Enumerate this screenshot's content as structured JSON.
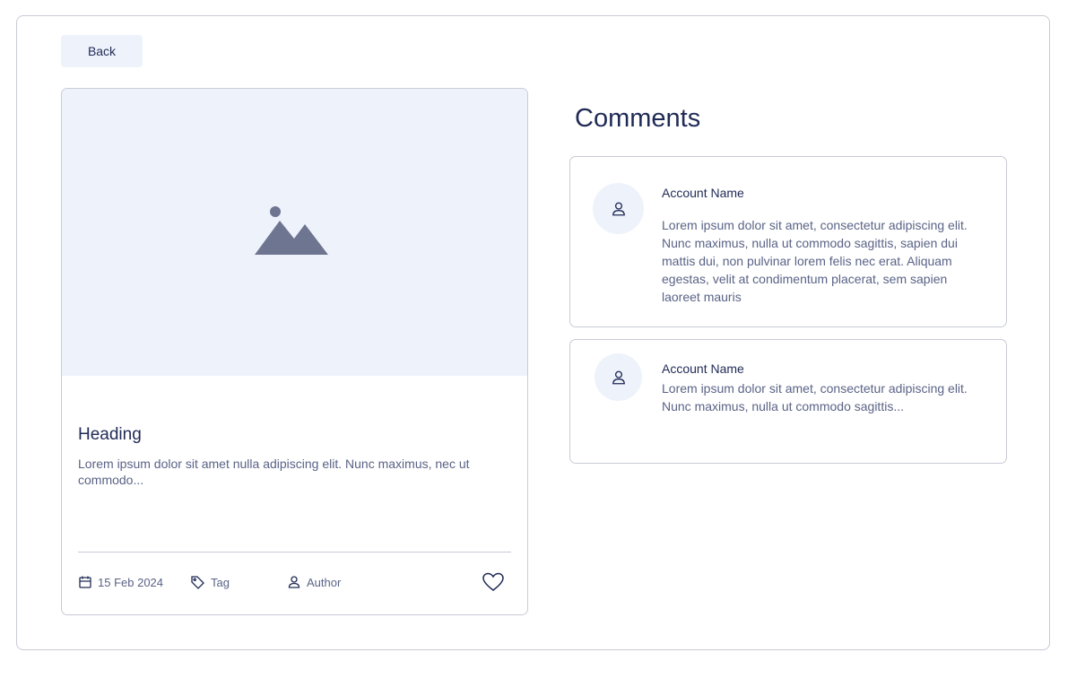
{
  "nav": {
    "back_label": "Back"
  },
  "post": {
    "heading": "Heading",
    "excerpt": "Lorem ipsum dolor sit amet nulla adipiscing elit. Nunc maximus, nec ut commodo...",
    "date": "15 Feb 2024",
    "tag": "Tag",
    "author": "Author",
    "image_icon": "image-placeholder-icon"
  },
  "comments": {
    "title": "Comments",
    "items": [
      {
        "account": "Account Name",
        "text": "Lorem ipsum dolor sit amet, consectetur adipiscing elit. Nunc maximus, nulla ut commodo sagittis, sapien dui mattis dui, non pulvinar lorem felis nec erat. Aliquam egestas, velit at condimentum placerat, sem sapien laoreet mauris"
      },
      {
        "account": "Account Name",
        "text": "Lorem ipsum dolor sit amet, consectetur adipiscing elit. Nunc maximus, nulla ut commodo sagittis..."
      }
    ]
  },
  "colors": {
    "primary_text": "#1f2a55",
    "secondary_text": "#5a6386",
    "border": "#c9cbd6",
    "surface_tint": "#eef2fa",
    "image_icon": "#6e7591"
  }
}
